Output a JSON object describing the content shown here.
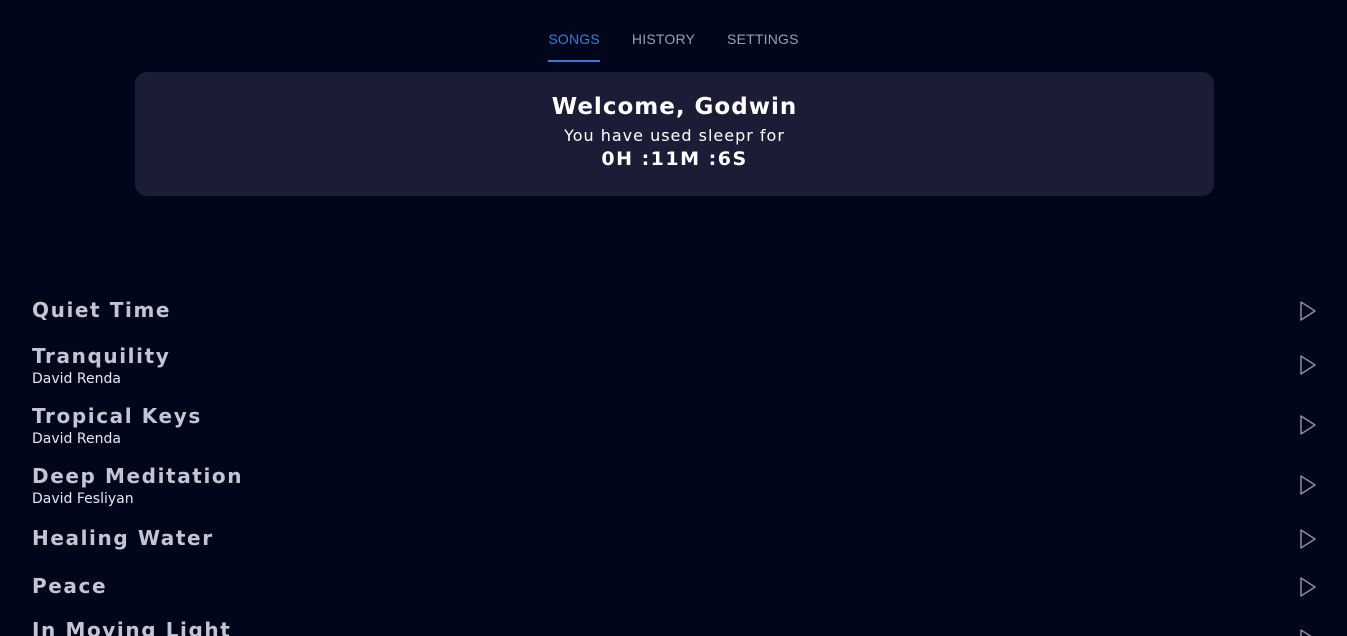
{
  "tabs": [
    {
      "label": "SONGS",
      "active": true
    },
    {
      "label": "HISTORY",
      "active": false
    },
    {
      "label": "SETTINGS",
      "active": false
    }
  ],
  "welcome": {
    "title": "Welcome, Godwin",
    "subtitle": "You have used sleepr for",
    "usage_time": "0H :11M :6S"
  },
  "songs": [
    {
      "title": "Quiet Time",
      "artist": ""
    },
    {
      "title": "Tranquility",
      "artist": "David Renda"
    },
    {
      "title": "Tropical Keys",
      "artist": "David Renda"
    },
    {
      "title": "Deep Meditation",
      "artist": "David Fesliyan"
    },
    {
      "title": "Healing Water",
      "artist": ""
    },
    {
      "title": "Peace",
      "artist": ""
    },
    {
      "title": "In Moving Light",
      "artist": ""
    }
  ],
  "icons": {
    "play": "play-icon"
  },
  "colors": {
    "background": "#02061b",
    "card": "#1a1d35",
    "accent": "#3a7bd5",
    "song_title": "#c3c6d1"
  }
}
